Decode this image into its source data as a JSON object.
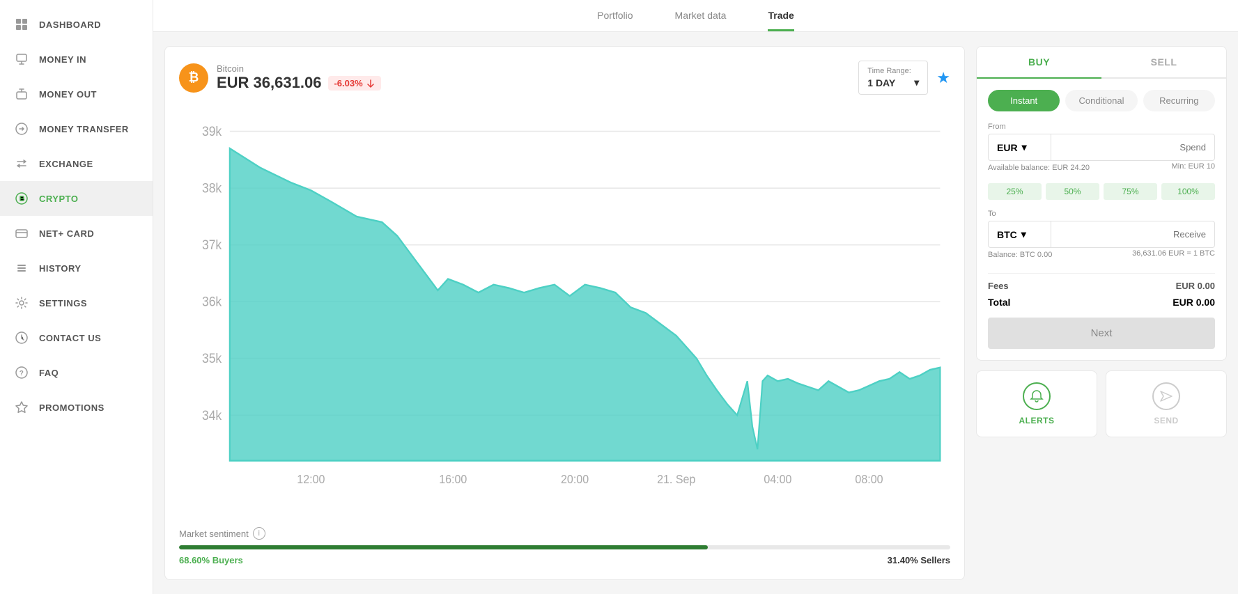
{
  "sidebar": {
    "items": [
      {
        "id": "dashboard",
        "label": "DASHBOARD",
        "icon": "⊞"
      },
      {
        "id": "money-in",
        "label": "MONEY IN",
        "icon": "↓"
      },
      {
        "id": "money-out",
        "label": "MONEY OUT",
        "icon": "↑"
      },
      {
        "id": "money-transfer",
        "label": "MONEY TRANSFER",
        "icon": "⇄"
      },
      {
        "id": "exchange",
        "label": "EXCHANGE",
        "icon": "⇌"
      },
      {
        "id": "crypto",
        "label": "CRYPTO",
        "icon": "✦",
        "active": true
      },
      {
        "id": "net-card",
        "label": "NET+ CARD",
        "icon": "▬"
      },
      {
        "id": "history",
        "label": "HISTORY",
        "icon": "☰"
      },
      {
        "id": "settings",
        "label": "SETTINGS",
        "icon": "⚙"
      },
      {
        "id": "contact-us",
        "label": "CONTACT US",
        "icon": "☎"
      },
      {
        "id": "faq",
        "label": "FAQ",
        "icon": "?"
      },
      {
        "id": "promotions",
        "label": "PROMOTIONS",
        "icon": "✦"
      }
    ]
  },
  "tabs": [
    {
      "id": "portfolio",
      "label": "Portfolio"
    },
    {
      "id": "market-data",
      "label": "Market data"
    },
    {
      "id": "trade",
      "label": "Trade",
      "active": true
    }
  ],
  "chart": {
    "coin_name": "Bitcoin",
    "coin_symbol": "BTC",
    "price": "EUR 36,631.06",
    "change": "-6.03%",
    "time_range_label": "Time Range:",
    "time_range_value": "1 DAY",
    "y_labels": [
      "39k",
      "38k",
      "37k",
      "36k",
      "35k",
      "34k"
    ],
    "x_labels": [
      "12:00",
      "16:00",
      "20:00",
      "21. Sep",
      "04:00",
      "08:00",
      ""
    ],
    "sentiment_label": "Market sentiment",
    "buyers_pct": "68.60% Buyers",
    "sellers_pct": "31.40% Sellers",
    "buyers_fill": 68.6
  },
  "buy_sell": {
    "buy_label": "BUY",
    "sell_label": "SELL",
    "order_types": [
      {
        "id": "instant",
        "label": "Instant",
        "active": true
      },
      {
        "id": "conditional",
        "label": "Conditional"
      },
      {
        "id": "recurring",
        "label": "Recurring"
      }
    ],
    "from_label": "From",
    "from_currency": "EUR",
    "spend_placeholder": "Spend",
    "available_balance": "Available balance: EUR 24.20",
    "min_amount": "Min: EUR 10",
    "percent_buttons": [
      "25%",
      "50%",
      "75%",
      "100%"
    ],
    "to_label": "To",
    "to_currency": "BTC",
    "receive_placeholder": "Receive",
    "balance_btc": "Balance: BTC 0.00",
    "exchange_rate": "36,631.06 EUR = 1 BTC",
    "fees_label": "Fees",
    "fees_value": "EUR 0.00",
    "total_label": "Total",
    "total_value": "EUR 0.00",
    "next_label": "Next"
  },
  "actions": [
    {
      "id": "alerts",
      "label": "ALERTS",
      "icon": "🔔",
      "active": true
    },
    {
      "id": "send",
      "label": "SEND",
      "icon": "✈",
      "active": false
    }
  ]
}
